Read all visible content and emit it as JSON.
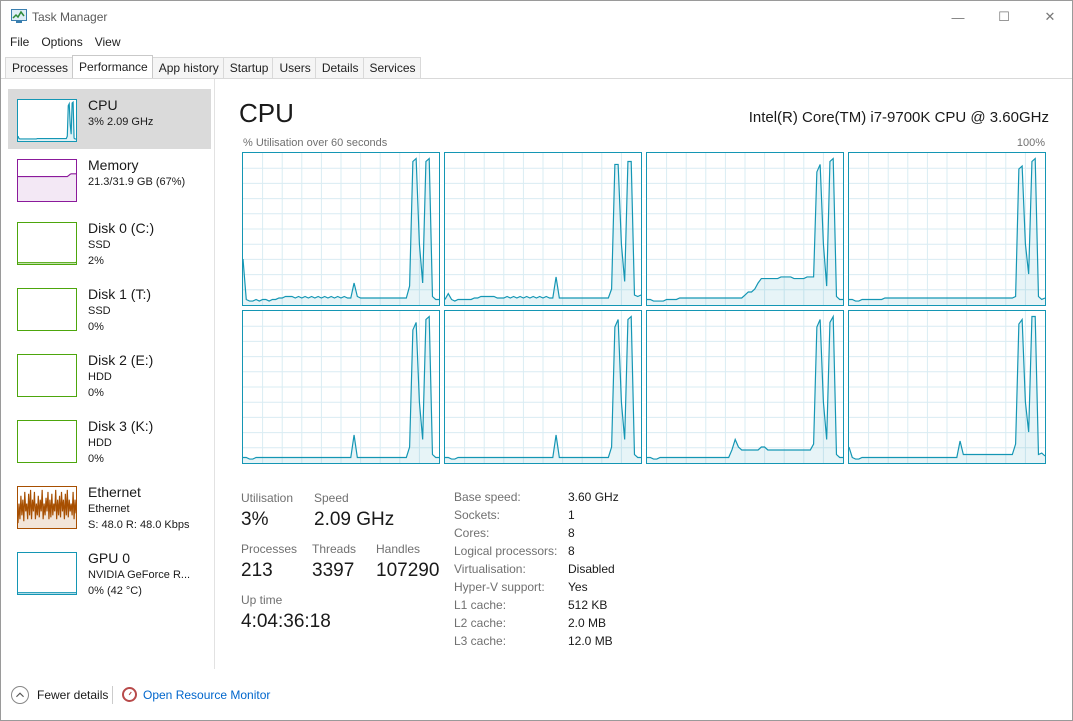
{
  "window": {
    "title": "Task Manager",
    "minimize": "—",
    "maximize": "☐",
    "close": "✕"
  },
  "menu": [
    "File",
    "Options",
    "View"
  ],
  "tabs": [
    "Processes",
    "Performance",
    "App history",
    "Startup",
    "Users",
    "Details",
    "Services"
  ],
  "active_tab": "Performance",
  "sidebar": [
    {
      "title": "CPU",
      "line1": "3% 2.09 GHz",
      "line2": "",
      "color": "#1496b4"
    },
    {
      "title": "Memory",
      "line1": "21.3/31.9 GB (67%)",
      "line2": "",
      "color": "#8b1a9b"
    },
    {
      "title": "Disk 0 (C:)",
      "line1": "SSD",
      "line2": "2%",
      "color": "#4da60c"
    },
    {
      "title": "Disk 1 (T:)",
      "line1": "SSD",
      "line2": "0%",
      "color": "#4da60c"
    },
    {
      "title": "Disk 2 (E:)",
      "line1": "HDD",
      "line2": "0%",
      "color": "#4da60c"
    },
    {
      "title": "Disk 3 (K:)",
      "line1": "HDD",
      "line2": "0%",
      "color": "#4da60c"
    },
    {
      "title": "Ethernet",
      "line1": "Ethernet",
      "line2": "S: 48.0  R: 48.0 Kbps",
      "color": "#a74f01"
    },
    {
      "title": "GPU 0",
      "line1": "NVIDIA GeForce R...",
      "line2": "0% (42 °C)",
      "color": "#1496b4"
    }
  ],
  "main": {
    "title": "CPU",
    "model": "Intel(R) Core(TM) i7-9700K CPU @ 3.60GHz",
    "graph_label": "% Utilisation over 60 seconds",
    "graph_max": "100%",
    "line_color": "#1496b4"
  },
  "stats": {
    "utilisation_label": "Utilisation",
    "utilisation": "3%",
    "speed_label": "Speed",
    "speed": "2.09 GHz",
    "processes_label": "Processes",
    "processes": "213",
    "threads_label": "Threads",
    "threads": "3397",
    "handles_label": "Handles",
    "handles": "107290",
    "uptime_label": "Up time",
    "uptime": "4:04:36:18"
  },
  "info": [
    {
      "label": "Base speed:",
      "value": "3.60 GHz"
    },
    {
      "label": "Sockets:",
      "value": "1"
    },
    {
      "label": "Cores:",
      "value": "8"
    },
    {
      "label": "Logical processors:",
      "value": "8"
    },
    {
      "label": "Virtualisation:",
      "value": "Disabled"
    },
    {
      "label": "Hyper-V support:",
      "value": "Yes"
    },
    {
      "label": "L1 cache:",
      "value": "512 KB"
    },
    {
      "label": "L2 cache:",
      "value": "2.0 MB"
    },
    {
      "label": "L3 cache:",
      "value": "12.0 MB"
    }
  ],
  "footer": {
    "fewer_details": "Fewer details",
    "resource_monitor": "Open Resource Monitor"
  },
  "chart_data": {
    "type": "line",
    "ylim": [
      0,
      100
    ],
    "x_range_seconds": 60,
    "series": [
      {
        "values": [
          30,
          3,
          2,
          2,
          3,
          2,
          3,
          3,
          2,
          3,
          3,
          4,
          4,
          5,
          5,
          5,
          4,
          5,
          4,
          5,
          4,
          5,
          4,
          5,
          4,
          5,
          4,
          5,
          4,
          5,
          4,
          5,
          4,
          4,
          14,
          5,
          4,
          4,
          4,
          4,
          4,
          4,
          4,
          4,
          4,
          4,
          4,
          4,
          4,
          4,
          4,
          12,
          95,
          97,
          40,
          14,
          95,
          97,
          5,
          3,
          3
        ]
      },
      {
        "values": [
          3,
          7,
          3,
          2,
          3,
          3,
          3,
          3,
          3,
          4,
          4,
          5,
          5,
          5,
          5,
          5,
          4,
          4,
          4,
          5,
          4,
          5,
          4,
          5,
          4,
          5,
          4,
          5,
          4,
          5,
          4,
          5,
          4,
          4,
          18,
          4,
          4,
          4,
          4,
          4,
          4,
          4,
          4,
          4,
          4,
          4,
          4,
          4,
          4,
          4,
          4,
          10,
          93,
          93,
          40,
          15,
          95,
          95,
          6,
          5,
          6
        ]
      },
      {
        "values": [
          3,
          3,
          2,
          2,
          2,
          2,
          3,
          3,
          3,
          3,
          4,
          4,
          4,
          4,
          4,
          4,
          4,
          4,
          4,
          4,
          4,
          4,
          4,
          4,
          4,
          4,
          4,
          4,
          4,
          4,
          6,
          8,
          8,
          10,
          14,
          17,
          17,
          17,
          17,
          17,
          17,
          18,
          18,
          18,
          18,
          17,
          17,
          17,
          17,
          18,
          18,
          18,
          88,
          93,
          40,
          12,
          95,
          97,
          5,
          3,
          3
        ]
      },
      {
        "values": [
          3,
          3,
          2,
          2,
          3,
          3,
          3,
          3,
          3,
          3,
          3,
          4,
          4,
          4,
          4,
          4,
          4,
          4,
          4,
          4,
          4,
          4,
          4,
          4,
          4,
          4,
          4,
          4,
          4,
          4,
          4,
          4,
          4,
          4,
          4,
          4,
          4,
          4,
          4,
          4,
          4,
          4,
          4,
          4,
          4,
          4,
          4,
          4,
          4,
          4,
          4,
          5,
          90,
          92,
          40,
          20,
          95,
          97,
          5,
          3,
          4
        ]
      },
      {
        "values": [
          3,
          3,
          2,
          2,
          3,
          3,
          3,
          3,
          3,
          3,
          3,
          3,
          3,
          3,
          3,
          3,
          3,
          3,
          3,
          3,
          3,
          3,
          3,
          3,
          3,
          3,
          3,
          3,
          3,
          3,
          3,
          3,
          3,
          3,
          18,
          3,
          3,
          3,
          3,
          3,
          3,
          3,
          3,
          3,
          3,
          3,
          3,
          3,
          3,
          3,
          3,
          10,
          88,
          93,
          40,
          15,
          95,
          97,
          5,
          3,
          3
        ]
      },
      {
        "values": [
          3,
          3,
          2,
          2,
          3,
          3,
          3,
          3,
          3,
          3,
          3,
          3,
          3,
          3,
          3,
          3,
          3,
          3,
          3,
          3,
          3,
          3,
          3,
          3,
          3,
          3,
          3,
          3,
          3,
          3,
          3,
          3,
          3,
          3,
          18,
          3,
          3,
          3,
          3,
          3,
          3,
          3,
          3,
          3,
          3,
          3,
          3,
          3,
          3,
          3,
          3,
          10,
          90,
          95,
          40,
          15,
          95,
          97,
          5,
          3,
          3
        ]
      },
      {
        "values": [
          3,
          3,
          2,
          2,
          3,
          3,
          3,
          3,
          3,
          3,
          3,
          3,
          3,
          3,
          3,
          3,
          3,
          3,
          3,
          3,
          3,
          3,
          3,
          3,
          3,
          3,
          8,
          15,
          10,
          8,
          8,
          8,
          8,
          8,
          8,
          10,
          10,
          8,
          8,
          8,
          8,
          8,
          8,
          8,
          8,
          8,
          8,
          8,
          8,
          8,
          8,
          12,
          90,
          95,
          40,
          15,
          93,
          97,
          5,
          3,
          3
        ]
      },
      {
        "values": [
          10,
          3,
          2,
          2,
          3,
          3,
          3,
          3,
          3,
          3,
          3,
          3,
          3,
          3,
          3,
          3,
          3,
          3,
          3,
          3,
          3,
          3,
          3,
          3,
          3,
          3,
          3,
          3,
          3,
          3,
          3,
          3,
          3,
          3,
          14,
          5,
          5,
          5,
          5,
          5,
          5,
          5,
          5,
          5,
          5,
          5,
          5,
          5,
          5,
          5,
          5,
          12,
          92,
          95,
          40,
          20,
          97,
          97,
          5,
          6,
          4
        ]
      }
    ],
    "thumbnails": {
      "cpu": [
        10,
        4,
        3,
        3,
        3,
        3,
        3,
        3,
        3,
        3,
        3,
        3,
        3,
        3,
        3,
        3,
        3,
        3,
        3,
        3,
        4,
        4,
        4,
        4,
        4,
        4,
        4,
        4,
        4,
        4,
        4,
        4,
        4,
        4,
        4,
        4,
        4,
        4,
        4,
        4,
        4,
        4,
        4,
        4,
        4,
        4,
        4,
        4,
        4,
        4,
        4,
        10,
        88,
        93,
        40,
        15,
        95,
        97,
        5,
        3,
        3
      ],
      "memory": [
        60,
        60,
        60,
        60,
        60,
        60,
        60,
        60,
        60,
        60,
        60,
        60,
        60,
        60,
        60,
        60,
        60,
        60,
        60,
        60,
        60,
        60,
        60,
        60,
        60,
        60,
        60,
        60,
        60,
        60,
        60,
        60,
        60,
        60,
        60,
        60,
        60,
        60,
        60,
        60,
        60,
        60,
        60,
        60,
        60,
        60,
        60,
        60,
        60,
        60,
        60,
        60,
        62,
        64,
        66,
        67,
        67,
        67,
        67,
        67,
        67
      ],
      "disk0": [
        1,
        1,
        1,
        1,
        1,
        1,
        1,
        1,
        1,
        1,
        1,
        1,
        1,
        1,
        1,
        1,
        1,
        1,
        1,
        1,
        1,
        1,
        1,
        1,
        1,
        1,
        1,
        1,
        1,
        1,
        1,
        1,
        1,
        1,
        1,
        1,
        1,
        1,
        1,
        1,
        1,
        1,
        1,
        1,
        1,
        1,
        1,
        1,
        1,
        1,
        1,
        1,
        1,
        1,
        1,
        1,
        1,
        1,
        1,
        1,
        2
      ],
      "ethernet": [
        10,
        60,
        20,
        80,
        30,
        70,
        15,
        90,
        40,
        60,
        20,
        85,
        30,
        95,
        20,
        70,
        40,
        90,
        20,
        60,
        30,
        80,
        25,
        70,
        40,
        95,
        20,
        60,
        30,
        75,
        40,
        90,
        20,
        70,
        25,
        85,
        30,
        60,
        40,
        95,
        20,
        70,
        30,
        80,
        25,
        90,
        40,
        70,
        20,
        85,
        30,
        95,
        25,
        70,
        40,
        60,
        30,
        90,
        20,
        70,
        35
      ],
      "gpu": [
        1,
        1,
        1,
        1,
        1,
        1,
        1,
        1,
        1,
        1,
        1,
        1,
        1,
        1,
        1,
        1,
        1,
        1,
        1,
        1,
        1,
        1,
        1,
        1,
        1,
        1,
        1,
        1,
        1,
        1,
        1,
        1,
        1,
        1,
        1,
        1,
        1,
        1,
        1,
        1,
        1,
        1,
        1,
        1,
        1,
        1,
        1,
        1,
        1,
        1,
        1,
        1,
        1,
        1,
        1,
        1,
        1,
        1,
        1,
        1,
        1
      ]
    }
  }
}
